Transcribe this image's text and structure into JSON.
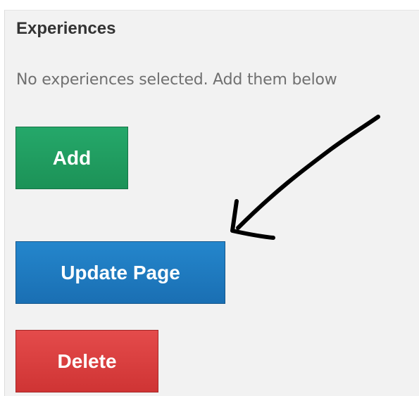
{
  "panel": {
    "title": "Experiences",
    "message": "No experiences selected. Add them below"
  },
  "buttons": {
    "add_label": "Add",
    "update_label": "Update Page",
    "delete_label": "Delete"
  },
  "colors": {
    "add": "#1f9a5e",
    "update": "#1e7cc0",
    "delete": "#d93b3b",
    "annotation": "#000000"
  },
  "icons": {
    "annotation": "arrow-annotation-icon"
  }
}
